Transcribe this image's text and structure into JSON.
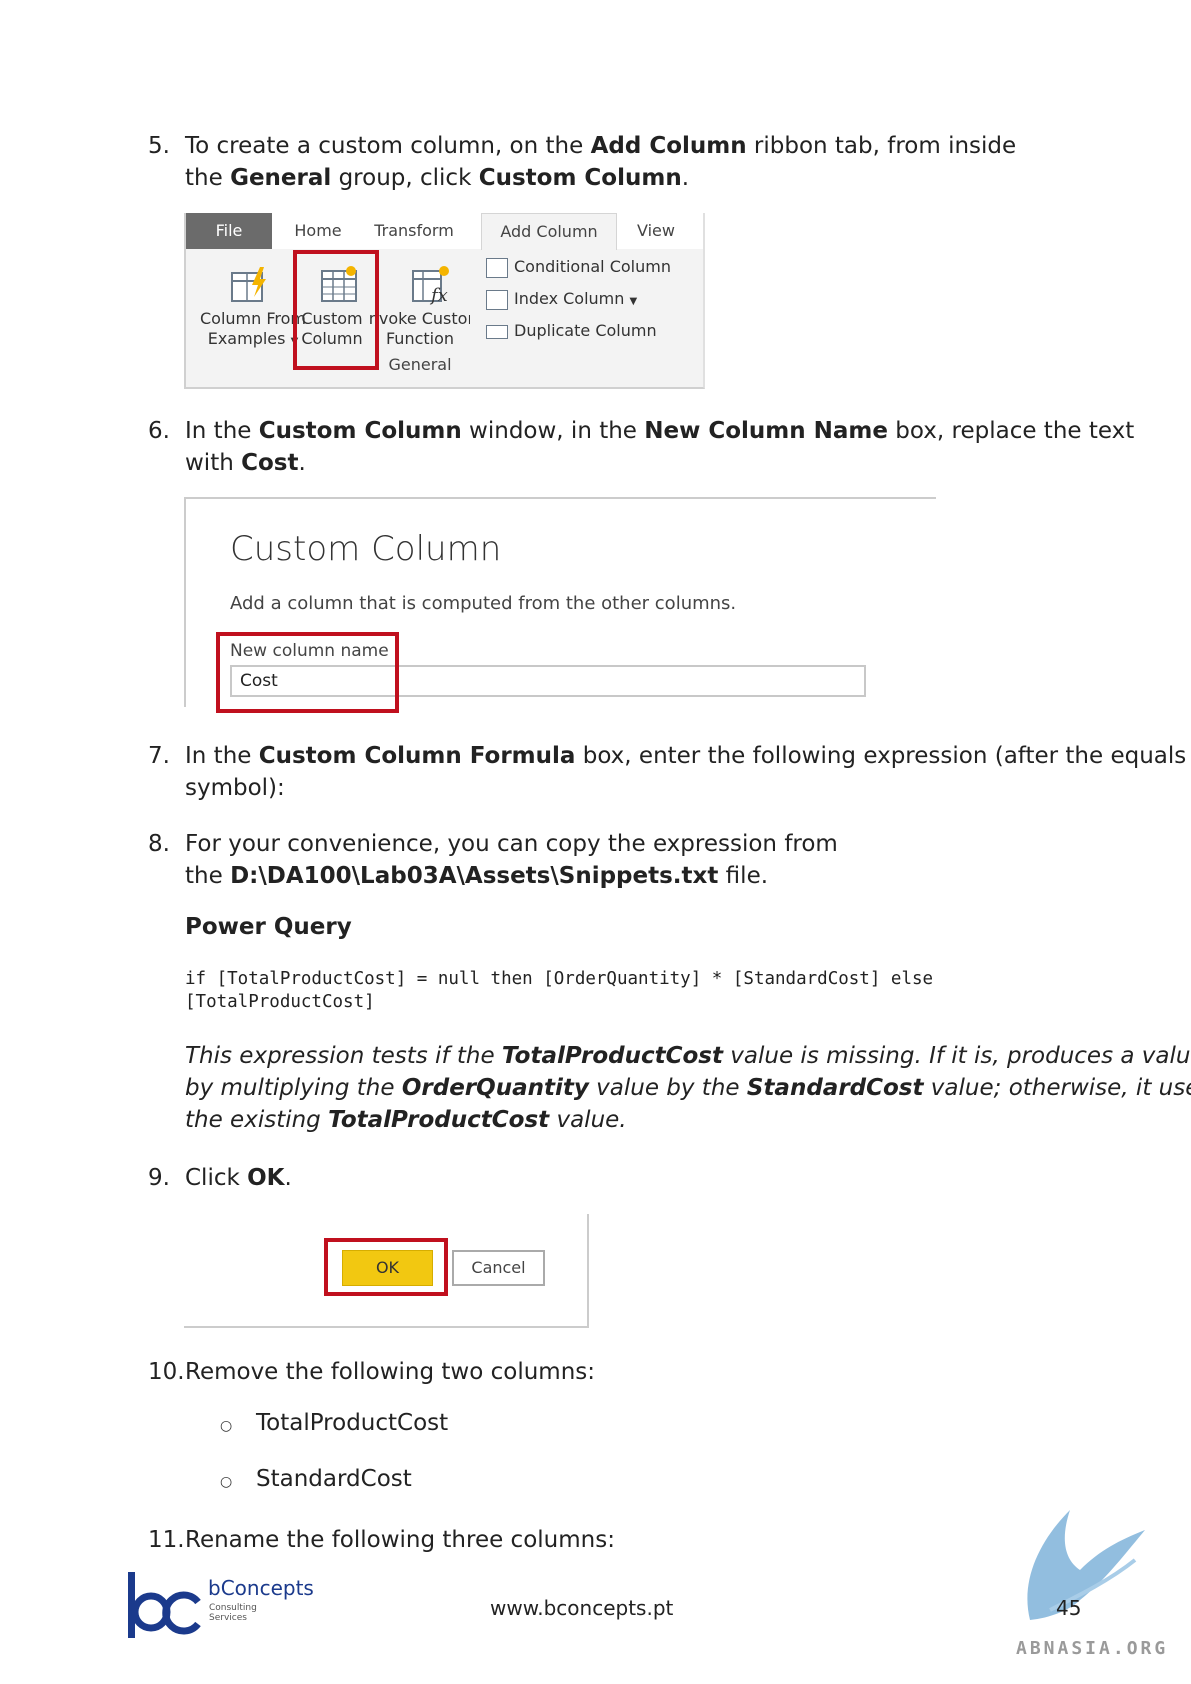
{
  "steps": {
    "s5": {
      "num": "5.",
      "l1a": "To create a custom column, on the ",
      "l1b": "Add Column",
      "l1c": " ribbon tab, from inside",
      "l2a": "the ",
      "l2b": "General",
      "l2c": " group, click ",
      "l2d": "Custom Column",
      "l2e": "."
    },
    "s6": {
      "num": "6.",
      "l1a": "In the ",
      "l1b": "Custom Column",
      "l1c": " window, in the ",
      "l1d": "New Column Name",
      "l1e": " box, replace the text",
      "l2a": "with ",
      "l2b": "Cost",
      "l2c": "."
    },
    "s7": {
      "num": "7.",
      "l1a": "In the ",
      "l1b": "Custom Column Formula",
      "l1c": " box, enter the following expression (after the equals",
      "l2": "symbol):"
    },
    "s8": {
      "num": "8.",
      "l1": "For your convenience, you can copy the expression from",
      "l2a": "the ",
      "l2b": "D:\\DA100\\Lab03A\\Assets\\Snippets.txt",
      "l2c": " file."
    },
    "s9": {
      "num": "9.",
      "a": "Click ",
      "b": "OK",
      "c": "."
    },
    "s10": {
      "num": "10.",
      "txt": "Remove the following two columns:"
    },
    "s11": {
      "num": "11.",
      "txt": "Rename the following three columns:"
    }
  },
  "ribbon": {
    "tabs": [
      "File",
      "Home",
      "Transform",
      "Add Column",
      "View"
    ],
    "column_from_examples": [
      "Column From",
      "Examples"
    ],
    "custom_column": [
      "Custom",
      "Column"
    ],
    "invoke_custom_function": [
      "Invoke Custom",
      "Function"
    ],
    "group_label": "General",
    "conditional_column": "Conditional Column",
    "index_column": "Index Column",
    "duplicate_column": "Duplicate Column"
  },
  "dialog": {
    "title": "Custom Column",
    "subtitle": "Add a column that is computed from the other columns.",
    "field_label": "New column name",
    "field_value": "Cost"
  },
  "power_query": {
    "heading": "Power Query",
    "code_line1": "if [TotalProductCost] = null then [OrderQuantity] * [StandardCost] else",
    "code_line2": "[TotalProductCost]"
  },
  "explanation": {
    "l1a": "This expression tests if the ",
    "l1b": "TotalProductCost",
    "l1c": " value is missing. If it is, produces a value",
    "l2a": "by multiplying the ",
    "l2b": "OrderQuantity",
    "l2c": " value by the ",
    "l2d": "StandardCost",
    "l2e": " value; otherwise, it uses",
    "l3a": "the existing ",
    "l3b": "TotalProductCost",
    "l3c": " value."
  },
  "buttons": {
    "ok": "OK",
    "cancel": "Cancel"
  },
  "remove_columns": [
    "TotalProductCost",
    "StandardCost"
  ],
  "footer": {
    "brand": "bConcepts",
    "brand_sub1": "Consulting",
    "brand_sub2": "Services",
    "url": "www.bconcepts.pt",
    "page": "45",
    "watermark": "ABNASIA.ORG"
  },
  "colors": {
    "highlight_red": "#c0101e",
    "ok_yellow": "#f2c811",
    "brand_blue": "#1b3a8c"
  }
}
